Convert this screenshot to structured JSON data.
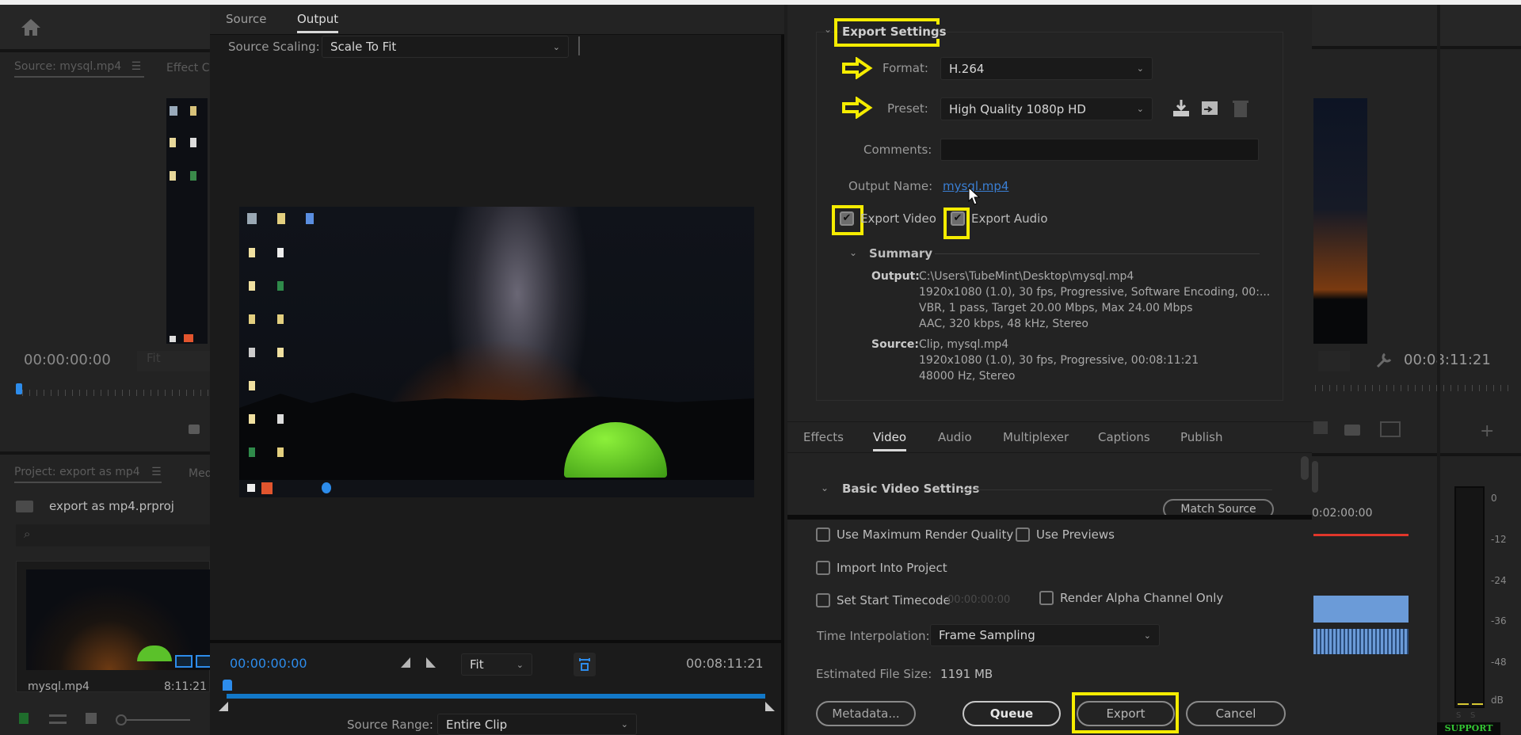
{
  "left_panel": {
    "source_tab": "Source: mysql.mp4",
    "effect_tab": "Effect C",
    "timecode": "00:00:00:00",
    "fit_label": "Fit",
    "project_tab": "Project: export as mp4",
    "media_tab": "Med",
    "project_file": "export as mp4.prproj",
    "clip_name": "mysql.mp4",
    "clip_duration": "8:11:21"
  },
  "export_dialog": {
    "tabs": [
      {
        "label": "Source"
      },
      {
        "label": "Output"
      }
    ],
    "active_tab": "Output",
    "source_scaling_label": "Source Scaling:",
    "source_scaling_value": "Scale To Fit",
    "current_timecode": "00:00:00:00",
    "end_timecode": "00:08:11:21",
    "fit_value": "Fit",
    "source_range_label": "Source Range:",
    "source_range_value": "Entire Clip",
    "playhead_position": 0.0
  },
  "export_settings": {
    "header": "Export Settings",
    "format_label": "Format:",
    "format_value": "H.264",
    "preset_label": "Preset:",
    "preset_value": "High Quality 1080p HD",
    "comments_label": "Comments:",
    "comments_value": "",
    "output_name_label": "Output Name:",
    "output_name_value": "mysql.mp4",
    "export_video_label": "Export Video",
    "export_video_checked": true,
    "export_audio_label": "Export Audio",
    "export_audio_checked": true,
    "summary_header": "Summary",
    "summary_output_key": "Output:",
    "summary_output_lines": [
      "C:\\Users\\TubeMint\\Desktop\\mysql.mp4",
      "1920x1080 (1.0), 30 fps, Progressive, Software Encoding, 00:...",
      "VBR, 1 pass, Target 20.00 Mbps, Max 24.00 Mbps",
      "AAC, 320 kbps, 48 kHz, Stereo"
    ],
    "summary_source_key": "Source:",
    "summary_source_lines": [
      "Clip, mysql.mp4",
      "1920x1080 (1.0), 30 fps, Progressive, 00:08:11:21",
      "48000 Hz, Stereo"
    ]
  },
  "settings_tabs": [
    {
      "label": "Effects"
    },
    {
      "label": "Video"
    },
    {
      "label": "Audio"
    },
    {
      "label": "Multiplexer"
    },
    {
      "label": "Captions"
    },
    {
      "label": "Publish"
    }
  ],
  "active_settings_tab": "Video",
  "basic_video": {
    "header": "Basic Video Settings",
    "match_source": "Match Source"
  },
  "options": {
    "max_render_quality": "Use Maximum Render Quality",
    "use_previews": "Use Previews",
    "import_into_project": "Import Into Project",
    "set_start_timecode": "Set Start Timecode",
    "start_timecode_value": "00:00:00:00",
    "render_alpha": "Render Alpha Channel Only",
    "time_interp_label": "Time Interpolation:",
    "time_interp_value": "Frame Sampling",
    "est_size_label": "Estimated File Size:",
    "est_size_value": "1191 MB"
  },
  "buttons": {
    "metadata": "Metadata...",
    "queue": "Queue",
    "export": "Export",
    "cancel": "Cancel"
  },
  "program_monitor": {
    "timecode": "00:08:11:21",
    "timeline_timecode": "0:02:00:00",
    "meter_labels": [
      "0",
      "-12",
      "-24",
      "-36",
      "-48",
      "dB"
    ],
    "solo_labels": [
      "S",
      "S"
    ],
    "support_label": "SUPPORT"
  },
  "colors": {
    "accent_blue": "#2d8ceb",
    "highlight_yellow": "#f5ec00",
    "timeline_red": "#e0362b"
  }
}
